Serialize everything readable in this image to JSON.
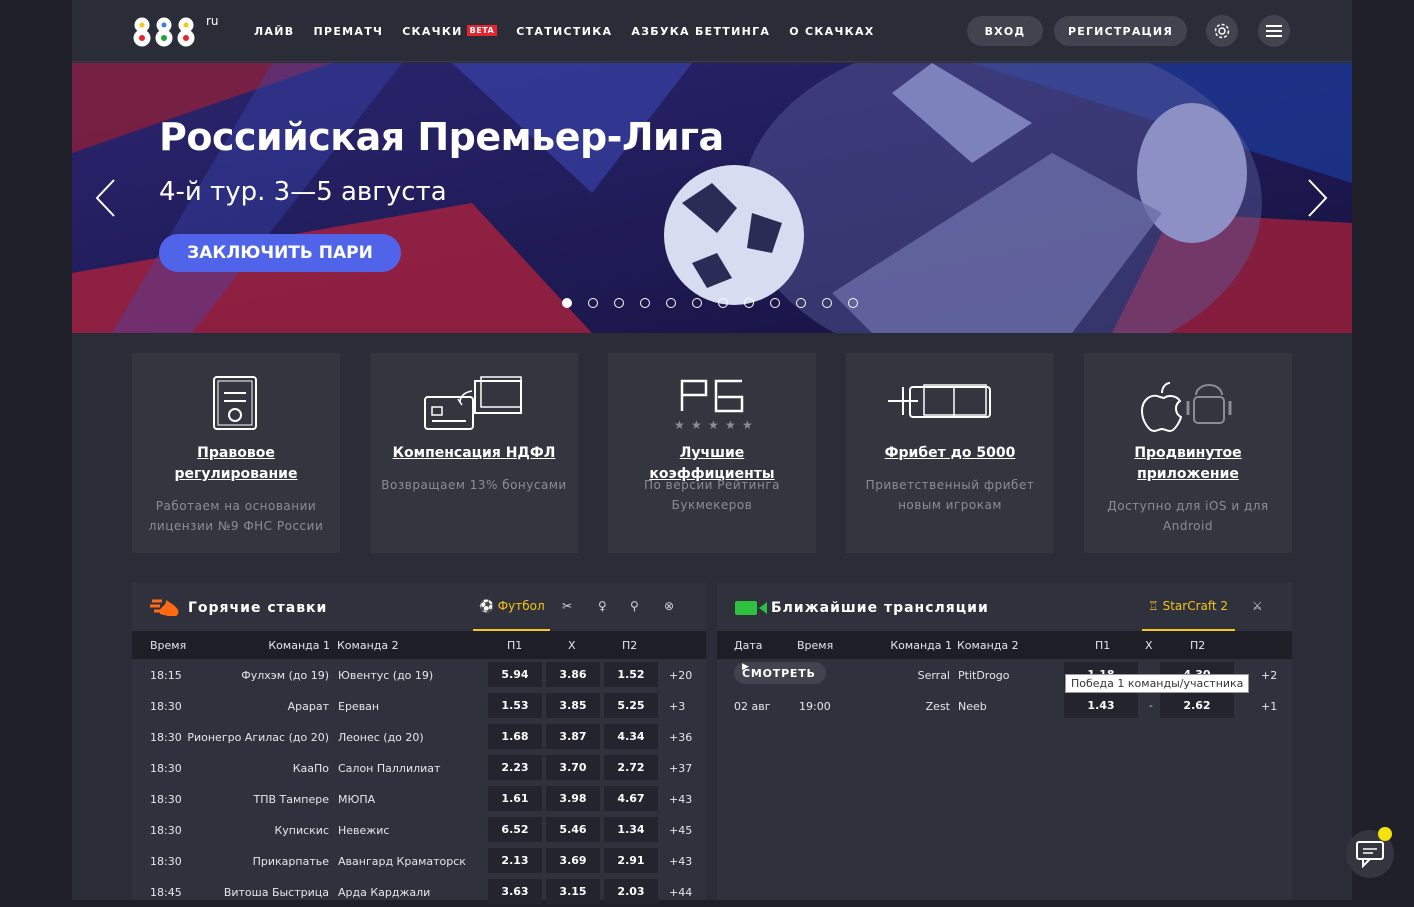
{
  "header": {
    "nav": [
      {
        "label": "ЛАЙВ"
      },
      {
        "label": "ПРЕМАТЧ"
      },
      {
        "label": "СКАЧКИ",
        "badge": "BETA"
      },
      {
        "label": "СТАТИСТИКА"
      },
      {
        "label": "АЗБУКА БЕТТИНГА"
      },
      {
        "label": "О СКАЧКАХ"
      }
    ],
    "login_label": "ВХОД",
    "register_label": "РЕГИСТРАЦИЯ",
    "logo_text": "888",
    "logo_sup": "ru"
  },
  "hero": {
    "title": "Российская Премьер-Лига",
    "subtitle": "4-й тур. 3—5 августа",
    "cta_label": "ЗАКЛЮЧИТЬ ПАРИ",
    "slide_count": 12,
    "active_slide": 1
  },
  "features": [
    {
      "icon": "document-icon",
      "title": "Правовое регулирование",
      "desc": "Работаем на основании лицензии №9 ФНС России"
    },
    {
      "icon": "card-transfer-icon",
      "title": "Компенсация НДФЛ",
      "desc": "Возвращаем 13% бонусами"
    },
    {
      "icon": "rb-rating-icon",
      "title": "Лучшие коэффициенты",
      "desc": "По версии Рейтинга Букмекеров"
    },
    {
      "icon": "freebet-icon",
      "title": "Фрибет до 5000",
      "desc": "Приветственный фрибет новым игрокам"
    },
    {
      "icon": "apple-android-icon",
      "title": "Продвинутое приложение",
      "desc": "Доступно для iOS и для Android"
    }
  ],
  "hot_bets": {
    "title": "Горячие ставки",
    "active_sport": "Футбол",
    "sports_icons": [
      "football-icon",
      "tennis-icon",
      "hockey-icon",
      "basketball-icon",
      "volleyball-icon"
    ],
    "headers": {
      "time": "Время",
      "team1": "Команда 1",
      "team2": "Команда 2",
      "p1": "П1",
      "x": "X",
      "p2": "П2"
    },
    "rows": [
      {
        "time": "18:15",
        "team1": "Фулхэм (до 19)",
        "team2": "Ювентус (до 19)",
        "p1": "5.94",
        "x": "3.86",
        "p2": "1.52",
        "more": "+20"
      },
      {
        "time": "18:30",
        "team1": "Арарат",
        "team2": "Ереван",
        "p1": "1.53",
        "x": "3.85",
        "p2": "5.25",
        "more": "+3"
      },
      {
        "time": "18:30",
        "team1": "Рионегро Агилас (до 20)",
        "team2": "Леонес (до 20)",
        "p1": "1.68",
        "x": "3.87",
        "p2": "4.34",
        "more": "+36"
      },
      {
        "time": "18:30",
        "team1": "КааПо",
        "team2": "Салон Паллилиат",
        "p1": "2.23",
        "x": "3.70",
        "p2": "2.72",
        "more": "+37"
      },
      {
        "time": "18:30",
        "team1": "ТПВ Тампере",
        "team2": "МЮПА",
        "p1": "1.61",
        "x": "3.98",
        "p2": "4.67",
        "more": "+43"
      },
      {
        "time": "18:30",
        "team1": "Купискис",
        "team2": "Невежис",
        "p1": "6.52",
        "x": "5.46",
        "p2": "1.34",
        "more": "+45"
      },
      {
        "time": "18:30",
        "team1": "Прикарпатье",
        "team2": "Авангард Краматорск",
        "p1": "2.13",
        "x": "3.69",
        "p2": "2.91",
        "more": "+43"
      },
      {
        "time": "18:45",
        "team1": "Витоша Быстрица",
        "team2": "Арда Карджали",
        "p1": "3.63",
        "x": "3.15",
        "p2": "2.03",
        "more": "+44"
      }
    ]
  },
  "broadcasts": {
    "title": "Ближайшие трансляции",
    "active_sport": "StarCraft 2",
    "headers": {
      "date": "Дата",
      "time": "Время",
      "team1": "Команда 1",
      "team2": "Команда 2",
      "p1": "П1",
      "x": "X",
      "p2": "П2"
    },
    "watch_label": "СМОТРЕТЬ",
    "rows": [
      {
        "date": "",
        "time": "",
        "team1": "Serral",
        "team2": "PtitDrogo",
        "p1": "1.18",
        "x": "",
        "p2": "4.30",
        "more": "+2"
      },
      {
        "date": "02 авг",
        "time": "19:00",
        "team1": "Zest",
        "team2": "Neeb",
        "p1": "1.43",
        "x": "-",
        "p2": "2.62",
        "more": "+1"
      }
    ],
    "tooltip": "Победа 1 команды/участника"
  }
}
